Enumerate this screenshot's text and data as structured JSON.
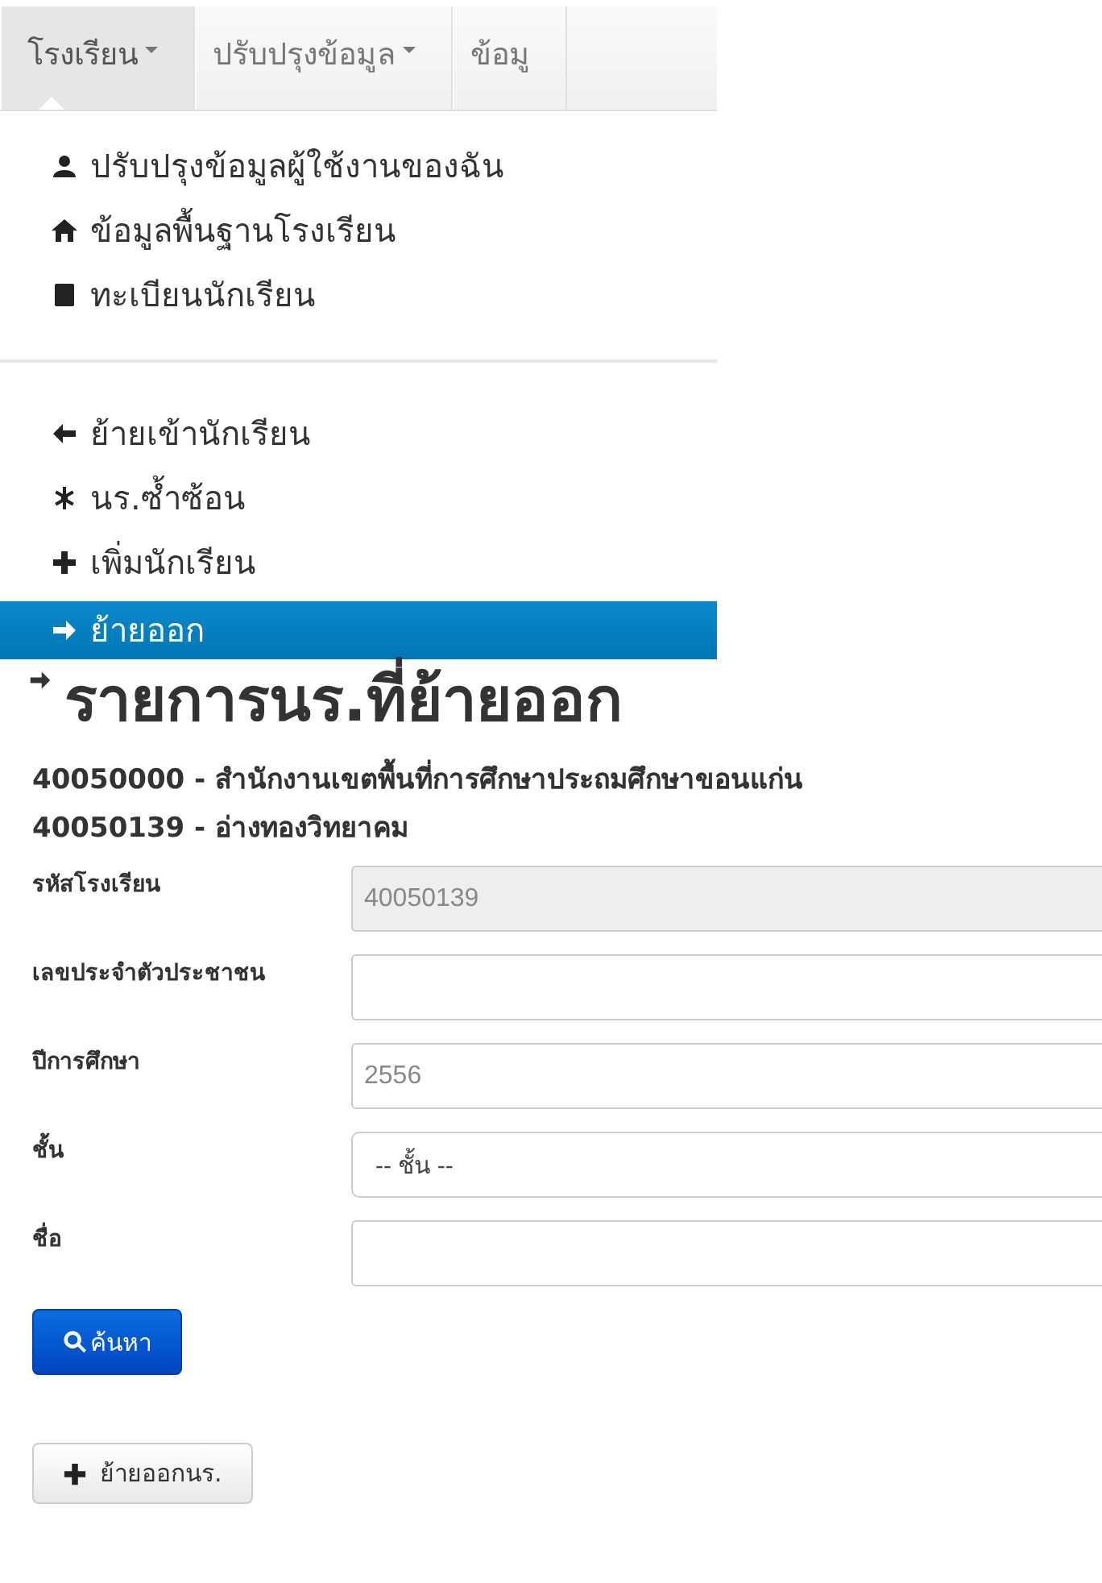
{
  "navbar": {
    "tabs": [
      {
        "label": "โรงเรียน",
        "caret": true,
        "selected": true
      },
      {
        "label": "ปรับปรุงข้อมูล",
        "caret": true,
        "selected": false
      },
      {
        "label": "ข้อมู",
        "caret": false,
        "selected": false
      }
    ]
  },
  "menu": {
    "sections": [
      {
        "items": [
          {
            "kind": "user",
            "label": "ปรับปรุงข้อมูลผู้ใช้งานของฉัน",
            "selected": false
          },
          {
            "kind": "home",
            "label": "ข้อมูลพื้นฐานโรงเรียน",
            "selected": false
          },
          {
            "kind": "book",
            "label": "ทะเบียนนักเรียน",
            "selected": false
          }
        ]
      },
      {
        "items": [
          {
            "kind": "arrow-left",
            "label": "ย้ายเข้านักเรียน",
            "selected": false
          },
          {
            "kind": "asterisk",
            "label": "นร.ซ้ำซ้อน",
            "selected": false
          },
          {
            "kind": "plus",
            "label": "เพิ่มนักเรียน",
            "selected": false
          },
          {
            "kind": "arrow-right",
            "label": "ย้ายออก",
            "selected": true
          }
        ]
      }
    ]
  },
  "page": {
    "title": "รายการนร.ที่ย้ายออก",
    "subtitles": [
      "40050000 - สำนักงานเขตพื้นที่การศึกษาประถมศึกษาขอนแก่น",
      "40050139 - อ่างทองวิทยาคม"
    ],
    "fields": [
      {
        "kind": "text",
        "label": "รหัสโรงเรียน",
        "placeholder": "40050139",
        "disabled": true
      },
      {
        "kind": "text",
        "label": "เลขประจำตัวประชาชน",
        "disabled": false
      },
      {
        "kind": "text",
        "label": "ปีการศึกษา",
        "placeholder": "2556",
        "disabled": false
      },
      {
        "kind": "select",
        "label": "ชั้น",
        "value": "-- ชั้น --",
        "disabled": false
      },
      {
        "kind": "text",
        "label": "ชื่อ",
        "disabled": false
      }
    ],
    "search_button": "ค้นหา",
    "add_button": "ย้ายออกนร."
  }
}
